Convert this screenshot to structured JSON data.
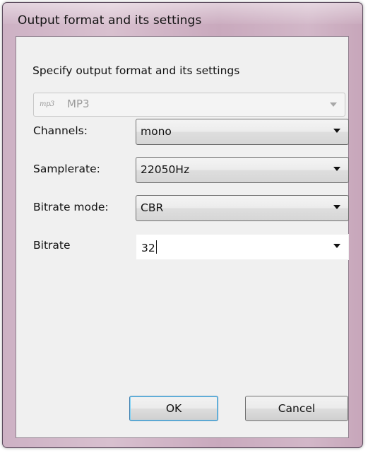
{
  "window": {
    "title": "Output format and its settings"
  },
  "dialog": {
    "heading": "Specify output format and its settings",
    "format": {
      "icon_text": "mp3",
      "value": "MP3"
    },
    "fields": {
      "channels": {
        "label": "Channels:",
        "value": "mono"
      },
      "samplerate": {
        "label": "Samplerate:",
        "value": "22050Hz"
      },
      "bitrate_mode": {
        "label": "Bitrate mode:",
        "value": "CBR"
      },
      "bitrate": {
        "label": "Bitrate",
        "value": "32"
      }
    },
    "buttons": {
      "ok": "OK",
      "cancel": "Cancel"
    }
  },
  "icons": {
    "format_logo": "mp3-logo-icon",
    "dropdown": "chevron-down-icon"
  }
}
